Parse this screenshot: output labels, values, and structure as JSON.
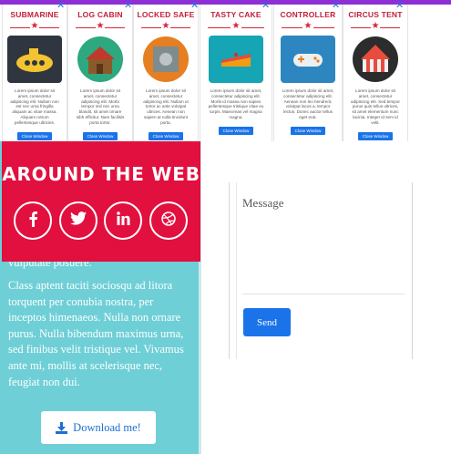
{
  "ads": [
    {
      "title": "SUBMARINE",
      "text": "Lorem ipsum dolor sit amet, consectetur adipiscing elit. Nullam non est nec urna fringilla aliquam ac vitae massa. Aliquam rutrum pellentesque ultricies.",
      "button": "Close Window",
      "icon": "submarine-icon"
    },
    {
      "title": "LOG CABIN",
      "text": "Lorem ipsum dolor sit amet, consectetur adipiscing elit. Morbi tempor nisl nec urna blandit, sit amet ornare nibh efficitur. Nam facilisis porta tortor.",
      "button": "Close Window",
      "icon": "log-cabin-icon"
    },
    {
      "title": "LOCKED SAFE",
      "text": "Lorem ipsum dolor sit amet, consectetur adipiscing elit. Nullam ut tortor ac ante volutpat ultrices. Aenean non sapien at nulla tincidunt porta.",
      "button": "Close Window",
      "icon": "locked-safe-icon"
    },
    {
      "title": "TASTY CAKE",
      "text": "Lorem ipsum dolor sit amet, consectetur adipiscing elit. Morbi id massa non sapien pellentesque tristique vitae eu turpis. Maecenas vel magna magna.",
      "button": "Close Window",
      "icon": "cake-icon"
    },
    {
      "title": "CONTROLLER",
      "text": "Lorem ipsum dolor sit amet, consectetur adipiscing elit. Aenean non leo hendrerit, volutpat lacus a, tempor lectus. Donec auctor tellus eget erat.",
      "button": "Close Window",
      "icon": "game-controller-icon"
    },
    {
      "title": "CIRCUS TENT",
      "text": "Lorem ipsum dolor sit amet, consectetur adipiscing elit. Sed tempor purus quis tellus ultrices, sit amet elementum nunc lacinia. Integer id sem id velit.",
      "button": "Close Window",
      "icon": "circus-tent-icon"
    }
  ],
  "around_the_web": {
    "title": "AROUND THE WEB",
    "social": [
      {
        "icon": "facebook-icon"
      },
      {
        "icon": "twitter-icon"
      },
      {
        "icon": "linkedin-icon"
      },
      {
        "icon": "dribbble-icon"
      }
    ]
  },
  "left": {
    "partial_line": "vulputate posuere.",
    "paragraph": "Class aptent taciti sociosqu ad litora torquent per conubia nostra, per inceptos himenaeos. Nulla non ornare purus. Nulla bibendum maximus urna, sed finibus velit tristique vel. Vivamus ante mi, mollis at scelerisque nec, feugiat non dui.",
    "download_label": "Download me!",
    "download_icon": "download-icon"
  },
  "form": {
    "message_placeholder": "Message",
    "send_label": "Send"
  },
  "colors": {
    "ad_title": "#c0203c",
    "accent_red": "#e1103f",
    "teal": "#6fcfd6",
    "primary_blue": "#1a73e8",
    "purple": "#8e2fd6"
  }
}
